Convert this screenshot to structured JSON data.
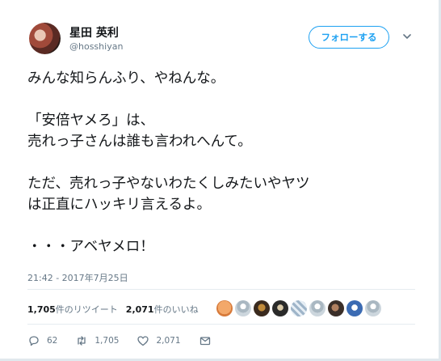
{
  "user": {
    "display_name": "星田 英利",
    "handle": "@hosshiyan",
    "follow_label": "フォローする"
  },
  "tweet": {
    "text": "みんな知らんふり、やねんな。\n\n「安倍ヤメろ」は、\n売れっ子さんは誰も言われへんて。\n\nただ、売れっ子やないわたくしみたいやヤツ\nは正直にハッキリ言えるよ。\n\n・・・アベヤメロ！",
    "timestamp": "21:42 - 2017年7月25日"
  },
  "stats": {
    "retweets_count": "1,705",
    "retweets_label": "件のリツイート",
    "likes_count": "2,071",
    "likes_label": "件のいいね"
  },
  "actions": {
    "reply_count": "62",
    "retweet_count": "1,705",
    "like_count": "2,071"
  },
  "icons": [
    "reply-icon",
    "retweet-icon",
    "heart-icon",
    "message-icon",
    "chevron-down-icon"
  ],
  "colors": {
    "accent": "#1da1f2",
    "secondary_text": "#657786",
    "primary_text": "#14171a"
  }
}
